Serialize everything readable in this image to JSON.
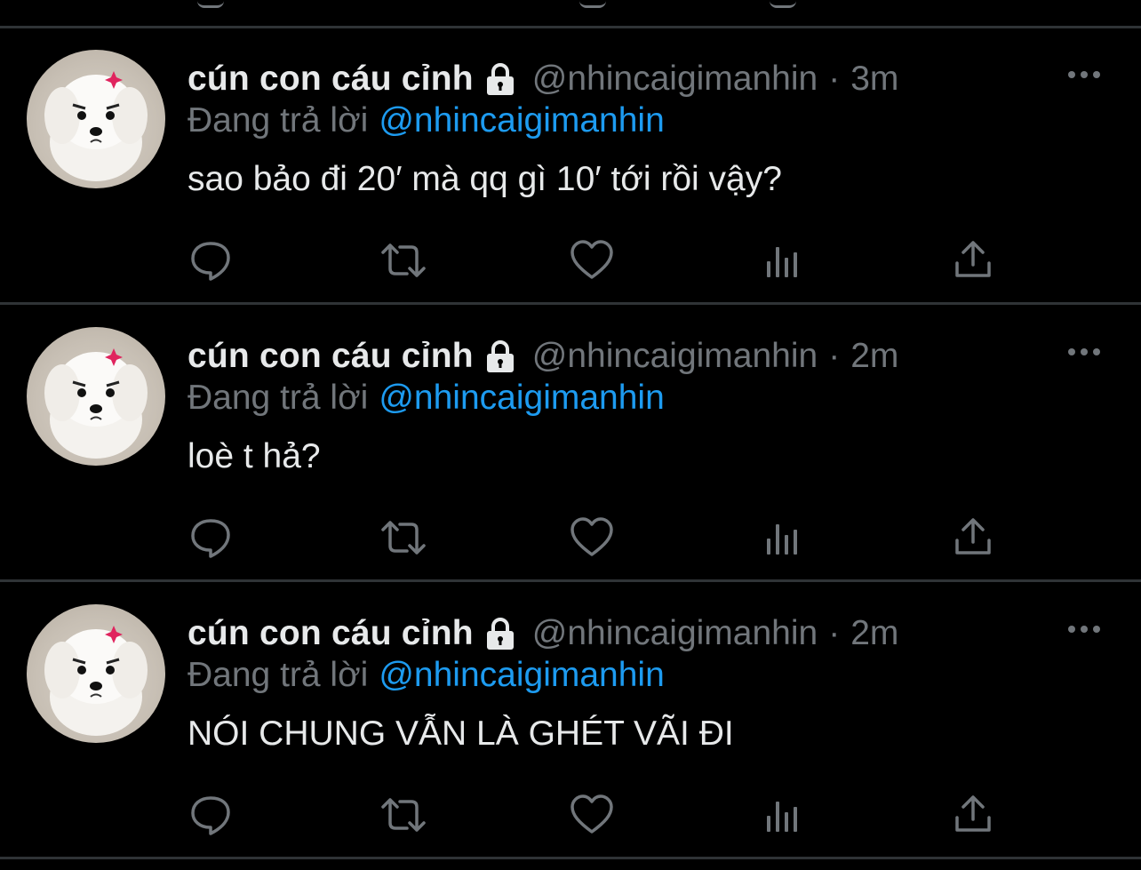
{
  "tweets": [
    {
      "display_name": "cún con cáu cỉnh",
      "handle": "@nhincaigimanhin",
      "separator": "·",
      "time": "3m",
      "reply_prefix": "Đang trả lời",
      "reply_mention": "@nhincaigimanhin",
      "text": "sao bảo đi 20′ mà qq gì 10′ tới rồi vậy?"
    },
    {
      "display_name": "cún con cáu cỉnh",
      "handle": "@nhincaigimanhin",
      "separator": "·",
      "time": "2m",
      "reply_prefix": "Đang trả lời",
      "reply_mention": "@nhincaigimanhin",
      "text": "loè t hả?"
    },
    {
      "display_name": "cún con cáu cỉnh",
      "handle": "@nhincaigimanhin",
      "separator": "·",
      "time": "2m",
      "reply_prefix": "Đang trả lời",
      "reply_mention": "@nhincaigimanhin",
      "text": "NÓI CHUNG VẪN LÀ GHÉT VÃI ĐI"
    }
  ],
  "icons": {
    "lock": "lock-icon",
    "more": "more-icon",
    "reply": "reply-icon",
    "retweet": "retweet-icon",
    "like": "heart-icon",
    "views": "views-icon",
    "share": "share-icon"
  },
  "colors": {
    "background": "#000000",
    "primary_text": "#e7e9ea",
    "secondary_text": "#71767b",
    "accent": "#1d9bf0",
    "divider": "#2f3336",
    "angry_badge": "#e0245e"
  }
}
